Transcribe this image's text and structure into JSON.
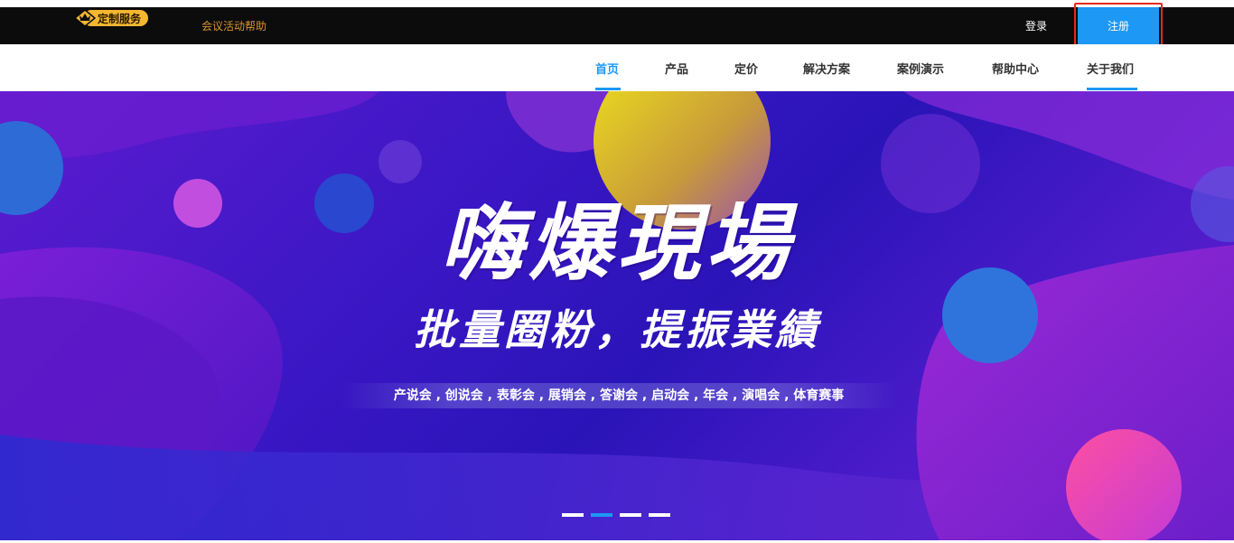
{
  "topbar": {
    "badge_label": "定制服务",
    "link_label": "会议活动帮助",
    "login_label": "登录",
    "register_label": "注册"
  },
  "nav": {
    "items": [
      {
        "label": "首页",
        "active": true
      },
      {
        "label": "产品",
        "active": false
      },
      {
        "label": "定价",
        "active": false
      },
      {
        "label": "解决方案",
        "active": false
      },
      {
        "label": "案例演示",
        "active": false
      },
      {
        "label": "帮助中心",
        "active": false
      },
      {
        "label": "关于我们",
        "active": false
      }
    ]
  },
  "banner": {
    "headline": "嗨爆現場",
    "subline": "批量圈粉，提振業績",
    "tagline": "产说会 , 创说会 , 表彰会 , 展销会 , 答谢会 , 启动会 , 年会 , 演唱会 , 体育赛事",
    "slides": 4,
    "active_slide": 2
  },
  "colors": {
    "accent": "#1d98f5",
    "badge": "#f5b731",
    "topbar": "#0c0c0c",
    "highlight_outline": "#e8281d"
  }
}
